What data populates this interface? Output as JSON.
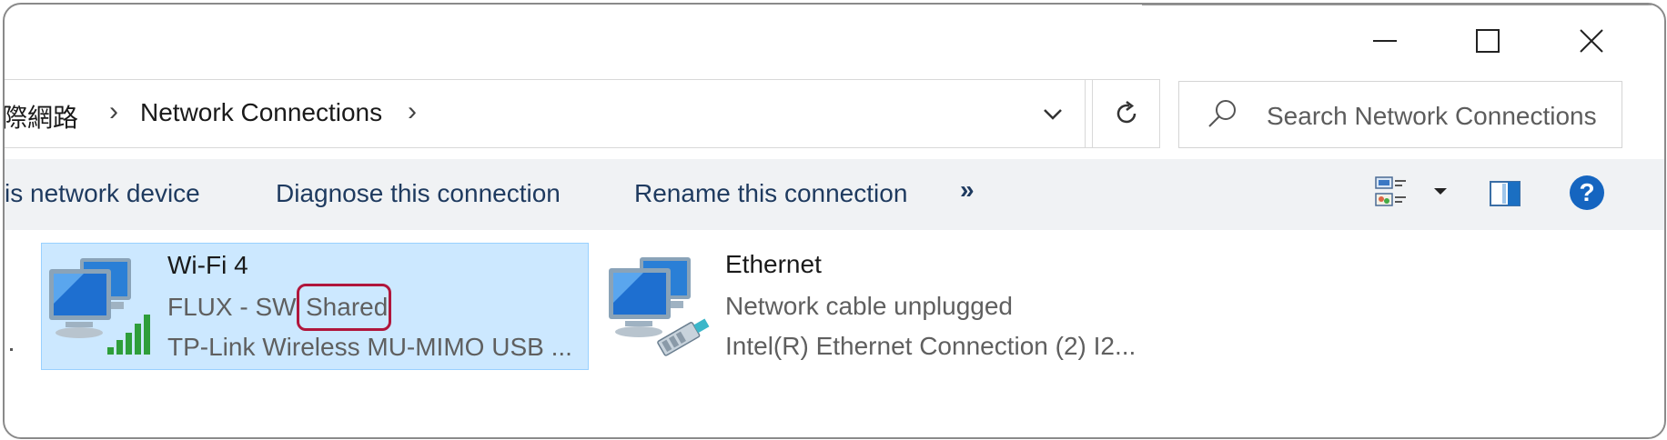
{
  "window": {
    "controls": {
      "minimize": "minimize",
      "maximize": "maximize",
      "close": "close"
    }
  },
  "address_bar": {
    "crumbs": [
      "網際網路",
      "Network Connections"
    ],
    "crumb_partial_visible": "際網路"
  },
  "search": {
    "placeholder": "Search Network Connections"
  },
  "command_bar": {
    "items": [
      "is network device",
      "Diagnose this connection",
      "Rename this connection"
    ],
    "more": "»"
  },
  "connections": [
    {
      "name": "Wi-Fi 4",
      "status": "FLUX - SW",
      "status_tag": "Shared",
      "device": "TP-Link Wireless MU-MIMO USB ...",
      "selected": true,
      "icon": "wifi-network-icon"
    },
    {
      "name": "Ethernet",
      "status": "Network cable unplugged",
      "device": "Intel(R) Ethernet Connection (2) I2...",
      "selected": false,
      "icon": "ethernet-network-icon"
    }
  ],
  "colors": {
    "selection_bg": "#cce8ff",
    "selection_border": "#99d1ff",
    "highlight": "#b0163c",
    "help": "#1565c0"
  }
}
